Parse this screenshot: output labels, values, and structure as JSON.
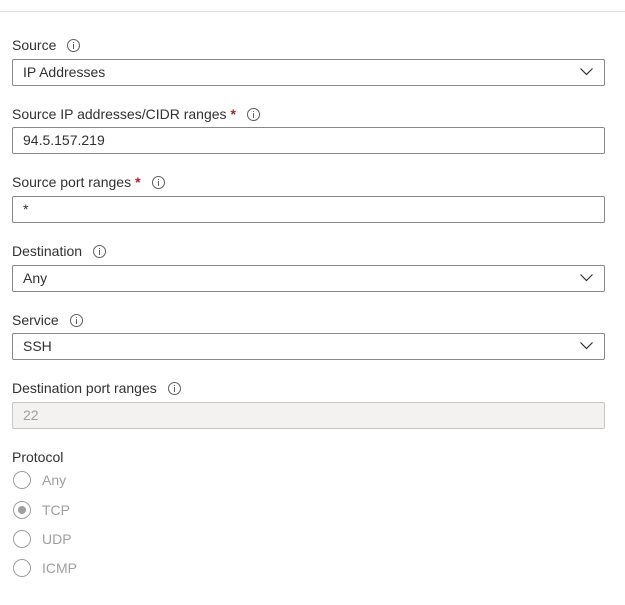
{
  "source": {
    "label": "Source",
    "value": "IP Addresses",
    "icon": "info-icon"
  },
  "source_ip": {
    "label": "Source IP addresses/CIDR ranges",
    "required_mark": "*",
    "value": "94.5.157.219"
  },
  "source_port": {
    "label": "Source port ranges",
    "required_mark": "*",
    "value": "*"
  },
  "destination": {
    "label": "Destination",
    "value": "Any"
  },
  "service": {
    "label": "Service",
    "value": "SSH"
  },
  "destination_port": {
    "label": "Destination port ranges",
    "value": "22",
    "disabled": true
  },
  "protocol": {
    "label": "Protocol",
    "selected": "TCP",
    "options": [
      {
        "label": "Any"
      },
      {
        "label": "TCP"
      },
      {
        "label": "UDP"
      },
      {
        "label": "ICMP"
      }
    ]
  },
  "colors": {
    "required": "#a4262c",
    "border": "#8a8886",
    "disabled_bg": "#f3f2f1",
    "disabled_text": "#a19f9d"
  }
}
